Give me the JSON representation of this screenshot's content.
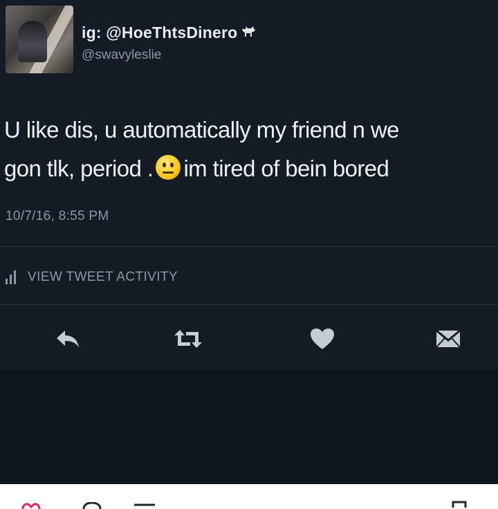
{
  "tweet": {
    "display_name": "ig: @HoeThtsDinero",
    "name_icon": "goat-icon",
    "handle": "@swavyleslie",
    "text_line1": "U like dis, u automatically my friend n we",
    "text_line2_before_emoji": "gon tlk, period .",
    "emoji": "neutral-face-emoji",
    "text_line2_after_emoji": "im tired of bein bored",
    "timestamp": "10/7/16, 8:55 PM",
    "activity_label": "VIEW TWEET ACTIVITY"
  },
  "actions": [
    {
      "name": "reply",
      "icon": "reply-icon"
    },
    {
      "name": "retweet",
      "icon": "retweet-icon"
    },
    {
      "name": "like",
      "icon": "heart-icon"
    },
    {
      "name": "message",
      "icon": "envelope-icon"
    }
  ],
  "colors": {
    "background": "#141b24",
    "text": "#eef1f4",
    "muted": "#8b98a5",
    "icon": "#c5ccd3"
  }
}
